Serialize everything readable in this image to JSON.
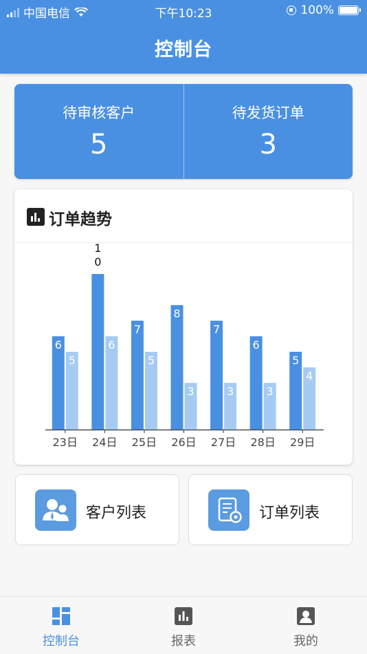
{
  "status_bar": {
    "carrier": "中国电信",
    "time": "下午10:23",
    "battery": "100%"
  },
  "header": {
    "title": "控制台"
  },
  "stats": [
    {
      "label": "待审核客户",
      "value": "5"
    },
    {
      "label": "待发货订单",
      "value": "3"
    }
  ],
  "chart_card": {
    "title": "订单趋势",
    "icon": "bar-chart-icon"
  },
  "chart_data": {
    "type": "bar",
    "title": "订单趋势",
    "categories": [
      "23日",
      "24日",
      "25日",
      "26日",
      "27日",
      "28日",
      "29日"
    ],
    "series": [
      {
        "values": [
          6,
          10,
          7,
          8,
          7,
          6,
          5
        ],
        "color": "#4a90e2"
      },
      {
        "values": [
          5,
          6,
          5,
          3,
          3,
          3,
          4
        ],
        "color": "#a6cbf3"
      }
    ],
    "ylim": [
      0,
      10
    ],
    "grid": false,
    "data_labels": true
  },
  "shortcuts": [
    {
      "label": "客户列表",
      "icon": "customers-icon"
    },
    {
      "label": "订单列表",
      "icon": "order-settings-icon"
    }
  ],
  "tabbar": {
    "items": [
      {
        "label": "控制台",
        "icon": "dashboard-icon",
        "active": true
      },
      {
        "label": "报表",
        "icon": "report-icon",
        "active": false
      },
      {
        "label": "我的",
        "icon": "profile-icon",
        "active": false
      }
    ],
    "active_color": "#4a90e2"
  }
}
